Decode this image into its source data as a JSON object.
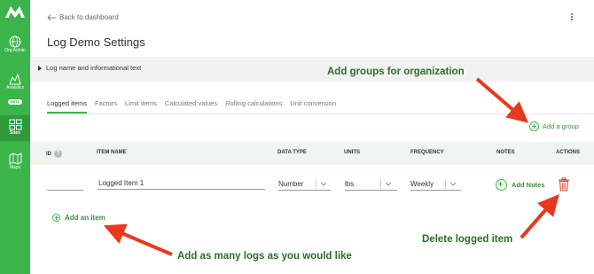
{
  "nav": {
    "org_admin": "Org Admin",
    "analytics": "Analytics",
    "beta": "BETA",
    "sites": "Sites",
    "maps": "Maps"
  },
  "header": {
    "back_label": "Back to dashboard",
    "title": "Log Demo Settings"
  },
  "accordion": {
    "label": "Log name and informational text"
  },
  "tabs": [
    "Logged items",
    "Factors",
    "Limit items",
    "Calculated values",
    "Rolling calculations",
    "Unit conversion"
  ],
  "actions": {
    "add_group": "Add a group",
    "add_notes": "Add Notes",
    "add_item": "Add an item"
  },
  "table": {
    "headers": {
      "id": "ID",
      "item_name": "ITEM NAME",
      "data_type": "DATA TYPE",
      "units": "UNITS",
      "frequency": "FREQUENCY",
      "notes": "NOTES",
      "actions": "ACTIONS"
    },
    "row": {
      "id": "",
      "item_name": "Logged Item 1",
      "data_type": "Number",
      "units": "lbs",
      "frequency": "Weekly"
    }
  },
  "callouts": {
    "groups": "Add groups for organization",
    "delete": "Delete logged item",
    "logs": "Add as many logs as you would like"
  },
  "colors": {
    "brand": "#3bb54a",
    "callout_text": "#2e6e2b",
    "arrow": "#e8391d",
    "trash": "#e23b2e"
  }
}
